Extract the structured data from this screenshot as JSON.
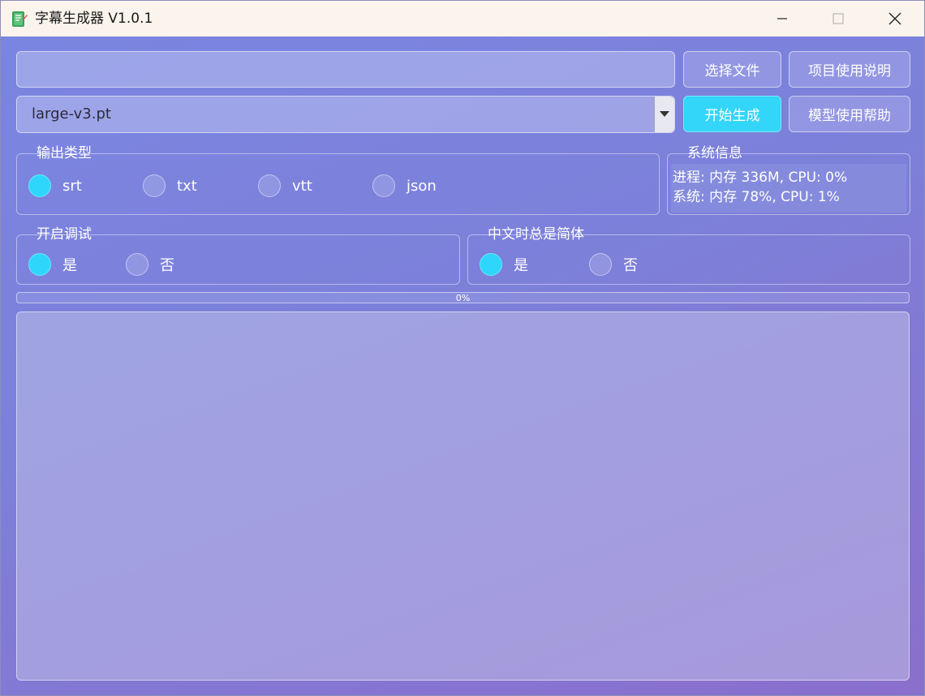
{
  "window": {
    "title": "字幕生成器 V1.0.1",
    "controls": {
      "minimize_icon": "minimize-icon",
      "maximize_icon": "maximize-icon",
      "close_icon": "close-icon"
    }
  },
  "file_input": {
    "value": "",
    "placeholder": ""
  },
  "buttons": {
    "select_file": "选择文件",
    "project_help": "项目使用说明",
    "start_generate": "开始生成",
    "model_help": "模型使用帮助"
  },
  "model_select": {
    "selected": "large-v3.pt"
  },
  "output_type": {
    "title": "输出类型",
    "options": [
      {
        "label": "srt",
        "selected": true
      },
      {
        "label": "txt",
        "selected": false
      },
      {
        "label": "vtt",
        "selected": false
      },
      {
        "label": "json",
        "selected": false
      }
    ]
  },
  "system_info": {
    "title": "系统信息",
    "lines": [
      "进程: 内存 336M, CPU: 0%",
      "系统: 内存 78%, CPU: 1%"
    ]
  },
  "debug": {
    "title": "开启调试",
    "options": [
      {
        "label": "是",
        "selected": true
      },
      {
        "label": "否",
        "selected": false
      }
    ]
  },
  "simplified": {
    "title": "中文时总是简体",
    "options": [
      {
        "label": "是",
        "selected": true
      },
      {
        "label": "否",
        "selected": false
      }
    ]
  },
  "progress": {
    "value": 0,
    "text": "0%"
  },
  "output_log": {
    "text": ""
  },
  "colors": {
    "accent": "#2fd6fb",
    "background": "#7a86e2",
    "titlebar": "#fbf4ec"
  }
}
